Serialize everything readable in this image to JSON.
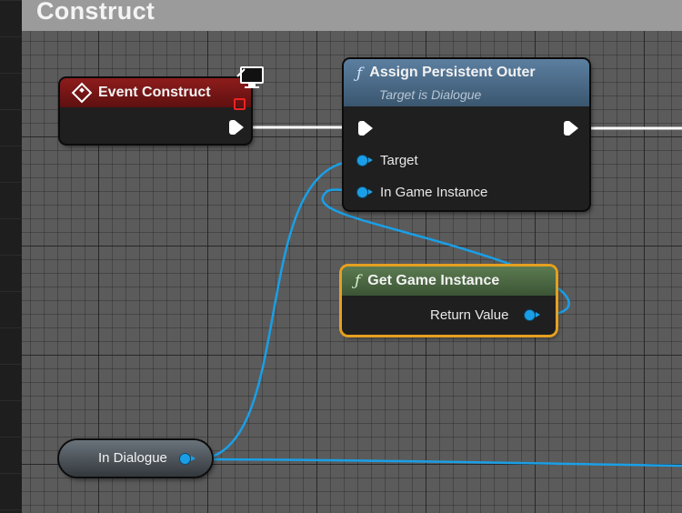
{
  "graph": {
    "title": "Construct"
  },
  "nodes": {
    "event_construct": {
      "title": "Event Construct"
    },
    "assign_persistent_outer": {
      "title": "Assign Persistent Outer",
      "subtitle": "Target is Dialogue",
      "inputs": [
        "Target",
        "In Game Instance"
      ]
    },
    "get_game_instance": {
      "title": "Get Game Instance",
      "output": "Return Value"
    },
    "variable": {
      "label": "In Dialogue"
    }
  },
  "icons": {
    "event": "event-diamond-icon",
    "function": "function-f-icon",
    "execution": "exec-arrow-icon",
    "data_pin": "object-pin-icon",
    "network": "client-monitor-icon"
  },
  "colors": {
    "event_header": "#8e1c1c",
    "function_header": "#4a6a8a",
    "pure_function_header": "#4e6b43",
    "selection_outline": "#e5a020",
    "object_wire": "#1a9fe6",
    "exec_wire": "#ffffff"
  }
}
